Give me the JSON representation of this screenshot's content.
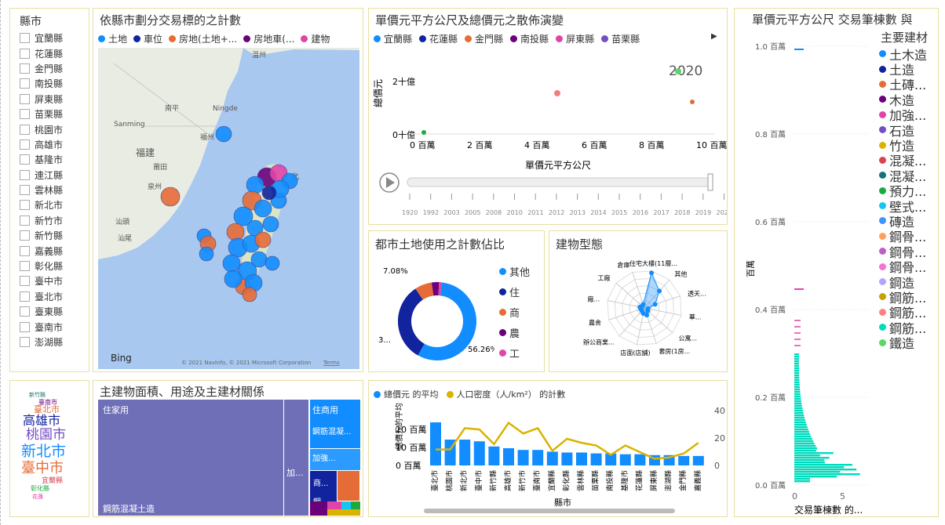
{
  "county_slicer": {
    "title": "縣市",
    "items": [
      "宜蘭縣",
      "花蓮縣",
      "金門縣",
      "南投縣",
      "屏東縣",
      "苗栗縣",
      "桃園市",
      "高雄市",
      "基隆市",
      "連江縣",
      "雲林縣",
      "新北市",
      "新竹市",
      "新竹縣",
      "嘉義縣",
      "彰化縣",
      "臺中市",
      "臺北市",
      "臺東縣",
      "臺南市",
      "澎湖縣"
    ]
  },
  "map_panel": {
    "title": "依縣市劃分交易標的之計數",
    "legend": [
      {
        "label": "土地",
        "color": "#118dff"
      },
      {
        "label": "車位",
        "color": "#12239e"
      },
      {
        "label": "房地(土地+...",
        "color": "#e66c37"
      },
      {
        "label": "房地車(...",
        "color": "#6b007b"
      },
      {
        "label": "建物",
        "color": "#e044a7"
      }
    ],
    "labels": {
      "wenzhou": "温州",
      "nanping": "南平",
      "ningde": "Ningde",
      "sanming": "Sanming",
      "fuzhou": "福州",
      "fujian": "福建",
      "putian": "莆田",
      "quanzhou": "泉州",
      "taipei": "北",
      "shantou": "汕頭",
      "shanwei": "汕尾"
    },
    "bing": "Bing",
    "copyright": "© 2021 NavInfo, © 2021 Microsoft Corporation",
    "terms": "Terms"
  },
  "scatter_panel": {
    "title": "單價元平方公尺及總價元之散佈演變",
    "legend": [
      {
        "label": "宜蘭縣",
        "color": "#118dff"
      },
      {
        "label": "花蓮縣",
        "color": "#12239e"
      },
      {
        "label": "金門縣",
        "color": "#e66c37"
      },
      {
        "label": "南投縣",
        "color": "#6b007b"
      },
      {
        "label": "屏東縣",
        "color": "#e044a7"
      },
      {
        "label": "苗栗縣",
        "color": "#744ec2"
      }
    ],
    "year": "2020",
    "ylabel": "總價元",
    "xlabel": "單價元平方公尺",
    "yticks": [
      "2十億",
      "0十億"
    ],
    "xticks": [
      "0 百萬",
      "2 百萬",
      "4 百萬",
      "6 百萬",
      "8 百萬",
      "10 百萬"
    ],
    "timeline": [
      "1920",
      "1992",
      "2003",
      "2005",
      "2008",
      "2010",
      "2011",
      "2012",
      "2013",
      "2014",
      "2015",
      "2016",
      "2017",
      "2018",
      "2019",
      "2020"
    ]
  },
  "donut_panel": {
    "title": "都市土地使用之計數佔比",
    "labels": {
      "top": "7.08%",
      "bottom_right": "56.26%",
      "left": "3..."
    },
    "legend": [
      {
        "label": "其他",
        "color": "#118dff"
      },
      {
        "label": "住",
        "color": "#12239e"
      },
      {
        "label": "商",
        "color": "#e66c37"
      },
      {
        "label": "農",
        "color": "#6b007b"
      },
      {
        "label": "工",
        "color": "#e044a7"
      }
    ]
  },
  "radar_panel": {
    "title": "建物型態",
    "labels": [
      "住宅大樓(11層...",
      "其他",
      "透天...",
      "華...",
      "公寓...",
      "套房(1房...",
      "店面(店舖)",
      "辦公商業...",
      "農舍",
      "廠...",
      "工廠",
      "倉庫"
    ]
  },
  "wordcloud": {
    "words": [
      "桃園市",
      "新北市",
      "臺中市",
      "高雄市",
      "臺南市",
      "臺北市",
      "彰化縣",
      "新竹縣",
      "宜蘭縣",
      "屏東縣",
      "花蓮",
      "苗栗",
      "基隆",
      "雲林",
      "嘉義"
    ]
  },
  "treemap_panel": {
    "title": "主建物面積、用途及主建材關係",
    "blocks": {
      "main_use": "住家用",
      "main_material": "鋼筋混凝土造",
      "side": "加...",
      "commerce": "住商用",
      "c_material": "鋼筋混凝...",
      "c_add": "加強...",
      "shop": "商...",
      "steel": "鋼..."
    }
  },
  "combo_panel": {
    "legend": [
      {
        "label": "總價元 的平均",
        "color": "#118dff"
      },
      {
        "label": "人口密度（人/km²） 的計數",
        "color": "#d9b300"
      }
    ],
    "ylabel": "總價元的平均",
    "y_left": [
      "20 百萬",
      "10 百萬",
      "0 百萬"
    ],
    "y_right": [
      "40",
      "20",
      "0"
    ],
    "xlabel": "縣市"
  },
  "chart_data": {
    "type": "bar",
    "categories": [
      "臺北市",
      "桃園市",
      "新北市",
      "臺中市",
      "新竹縣",
      "高雄市",
      "新竹市",
      "臺南市",
      "宜蘭縣",
      "彰化縣",
      "雲林縣",
      "苗栗縣",
      "南投縣",
      "基隆市",
      "花蓮縣",
      "屏東縣",
      "澎湖縣",
      "金門縣",
      "嘉義縣"
    ],
    "series": [
      {
        "name": "總價元 的平均",
        "values": [
          25,
          15,
          15,
          14,
          11,
          10,
          9,
          9,
          8,
          7.5,
          7.5,
          7,
          7,
          6.5,
          6.5,
          6,
          6,
          5.5,
          5.5
        ]
      },
      {
        "name": "人口密度（人/km²） 的計數",
        "values": [
          12,
          12,
          28,
          27,
          16,
          32,
          24,
          28,
          11,
          20,
          17,
          15,
          8,
          15,
          10,
          5,
          6,
          9,
          17
        ]
      }
    ],
    "y_left_range": [
      0,
      27
    ],
    "y_right_range": [
      0,
      50
    ]
  },
  "hist_panel": {
    "title_line1": "單價元平方公尺 交易筆棟數 與",
    "title_line2": "主要建材",
    "ylabel": "百萬",
    "yticks": [
      "1.0 百萬",
      "0.8 百萬",
      "0.6 百萬",
      "0.4 百萬",
      "0.2 百萬",
      "0.0 百萬"
    ],
    "xticks": [
      "0",
      "5"
    ],
    "xlabel": "交易筆棟數 的...",
    "legend": [
      {
        "label": "土木造",
        "color": "#118dff"
      },
      {
        "label": "土造",
        "color": "#12239e"
      },
      {
        "label": "土磚...",
        "color": "#e66c37"
      },
      {
        "label": "木造",
        "color": "#6b007b"
      },
      {
        "label": "加強...",
        "color": "#e044a7"
      },
      {
        "label": "石造",
        "color": "#744ec2"
      },
      {
        "label": "竹造",
        "color": "#d9b300"
      },
      {
        "label": "混凝...",
        "color": "#d64550"
      },
      {
        "label": "混凝...",
        "color": "#197278"
      },
      {
        "label": "預力...",
        "color": "#1aab40"
      },
      {
        "label": "壁式...",
        "color": "#15c6f4"
      },
      {
        "label": "磚造",
        "color": "#4092ff"
      },
      {
        "label": "鋼骨...",
        "color": "#ffa058"
      },
      {
        "label": "鋼骨...",
        "color": "#be5dc9"
      },
      {
        "label": "鋼骨...",
        "color": "#f472d0"
      },
      {
        "label": "鋼造",
        "color": "#b5a1ff"
      },
      {
        "label": "鋼筋...",
        "color": "#c4a200"
      },
      {
        "label": "鋼筋...",
        "color": "#ff8080"
      },
      {
        "label": "鋼筋...",
        "color": "#00dbbc"
      },
      {
        "label": "鐵造",
        "color": "#5bd667"
      }
    ]
  }
}
